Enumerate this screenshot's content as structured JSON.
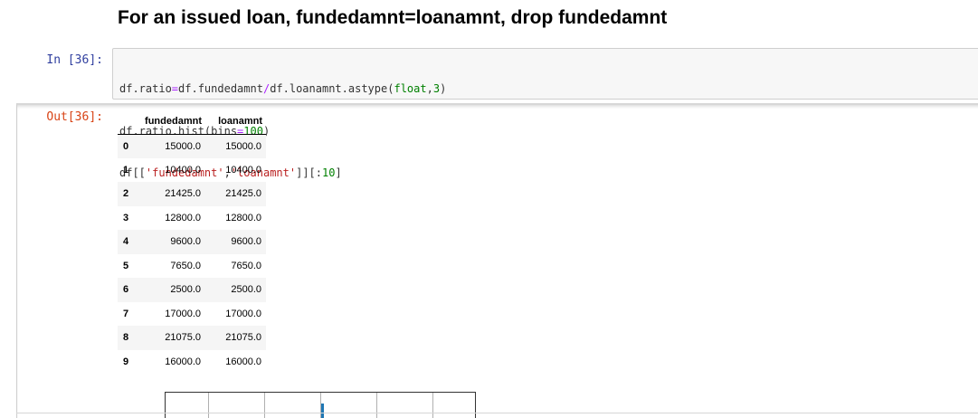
{
  "markdown": {
    "heading": "For an issued loan, fundedamnt=loanamnt, drop fundedamnt"
  },
  "cell": {
    "in_prompt": "In [36]:",
    "out_prompt": "Out[36]:",
    "code": {
      "line1": {
        "a": "df.ratio",
        "b": "=",
        "c": "df.fundedamnt",
        "d": "/",
        "e": "df.loanamnt.astype(",
        "f": "float",
        "g": ",",
        "h": "3",
        "i": ")"
      },
      "line2": {
        "a": "df.ratio.hist(bins",
        "b": "=",
        "c": "100",
        "d": ")"
      },
      "line3": {
        "a": "df[[",
        "b": "'fundedamnt'",
        "c": ",",
        "d": "'loanamnt'",
        "e": "]][:",
        "f": "10",
        "g": "]"
      }
    }
  },
  "output_table": {
    "columns": [
      "",
      "fundedamnt",
      "loanamnt"
    ],
    "rows": [
      {
        "index": "0",
        "fundedamnt": "15000.0",
        "loanamnt": "15000.0"
      },
      {
        "index": "1",
        "fundedamnt": "10400.0",
        "loanamnt": "10400.0"
      },
      {
        "index": "2",
        "fundedamnt": "21425.0",
        "loanamnt": "21425.0"
      },
      {
        "index": "3",
        "fundedamnt": "12800.0",
        "loanamnt": "12800.0"
      },
      {
        "index": "4",
        "fundedamnt": "9600.0",
        "loanamnt": "9600.0"
      },
      {
        "index": "5",
        "fundedamnt": "7650.0",
        "loanamnt": "7650.0"
      },
      {
        "index": "6",
        "fundedamnt": "2500.0",
        "loanamnt": "2500.0"
      },
      {
        "index": "7",
        "fundedamnt": "17000.0",
        "loanamnt": "17000.0"
      },
      {
        "index": "8",
        "fundedamnt": "21075.0",
        "loanamnt": "21075.0"
      },
      {
        "index": "9",
        "fundedamnt": "16000.0",
        "loanamnt": "16000.0"
      }
    ]
  },
  "colors": {
    "in_prompt": "#303f9f",
    "out_prompt": "#d84315",
    "histogram_bar": "#1f77b4"
  }
}
